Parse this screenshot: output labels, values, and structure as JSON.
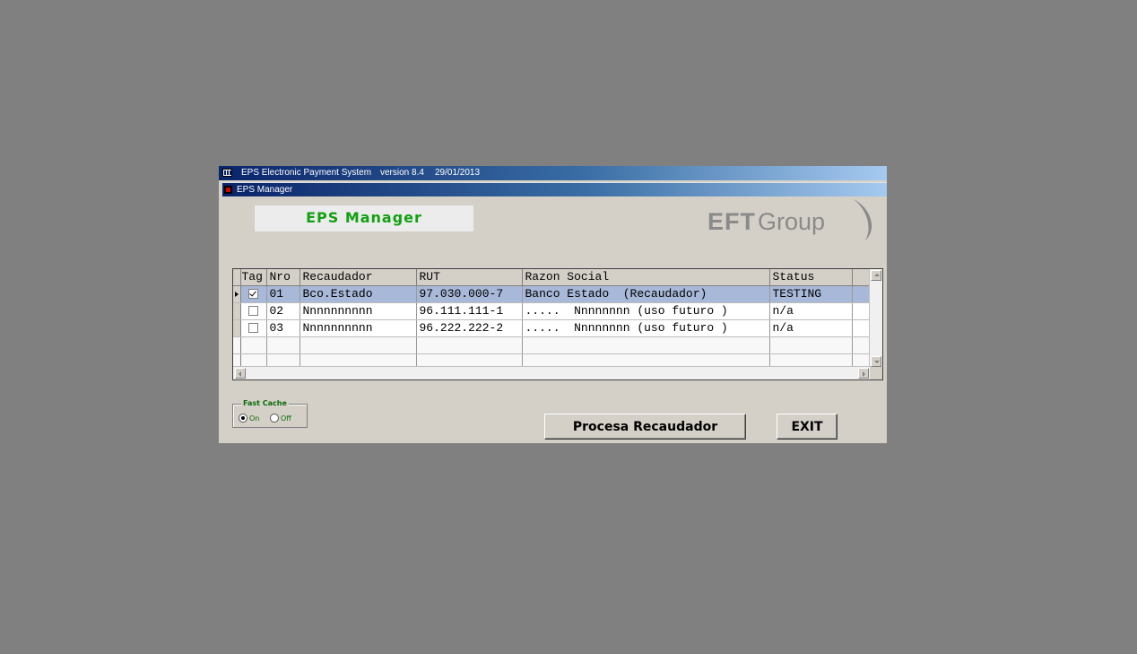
{
  "window": {
    "app_name": "EPS Electronic Payment System",
    "version": "version 8.4",
    "date": "29/01/2013",
    "subtitle": "EPS Manager"
  },
  "header": {
    "title": "EPS  Manager"
  },
  "logo": {
    "text_eft": "EFT",
    "text_group": "Group",
    "color": "#8a8a8a"
  },
  "grid": {
    "columns": [
      "Tag",
      "Nro",
      "Recaudador",
      "RUT",
      "Razon Social",
      "Status"
    ],
    "rows": [
      {
        "tag_checked": true,
        "nro": "01",
        "recaudador": "Bco.Estado",
        "rut": "97.030.000-7",
        "razon_social": "Banco Estado  (Recaudador)",
        "status": "TESTING",
        "selected": true
      },
      {
        "tag_checked": false,
        "nro": "02",
        "recaudador": "Nnnnnnnnnn",
        "rut": "96.111.111-1",
        "razon_social": ".....  Nnnnnnnn (uso futuro )",
        "status": "n/a",
        "selected": false
      },
      {
        "tag_checked": false,
        "nro": "03",
        "recaudador": "Nnnnnnnnnn",
        "rut": "96.222.222-2",
        "razon_social": ".....  Nnnnnnnn (uso futuro )",
        "status": "n/a",
        "selected": false
      }
    ]
  },
  "fast_cache": {
    "label": "Fast Cache",
    "on_label": "On",
    "off_label": "Off",
    "selected": "On"
  },
  "buttons": {
    "procesa": "Procesa Recaudador",
    "exit": "EXIT"
  },
  "colors": {
    "title_gradient_start": "#0a246a",
    "header_text": "#12a012",
    "selected_row": "#a8b8d8"
  }
}
